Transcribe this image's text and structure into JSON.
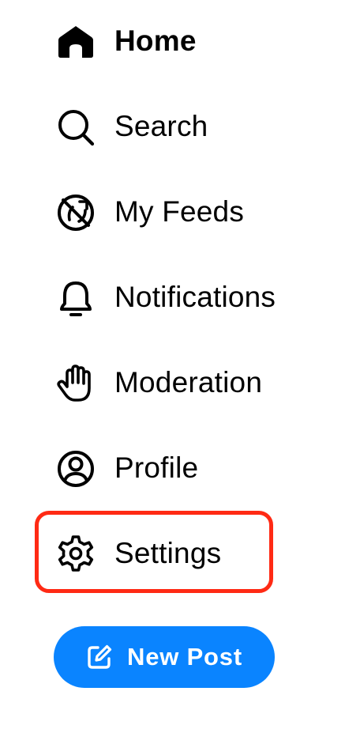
{
  "nav": {
    "items": [
      {
        "label": "Home",
        "icon": "home-icon",
        "active": true
      },
      {
        "label": "Search",
        "icon": "search-icon",
        "active": false
      },
      {
        "label": "My Feeds",
        "icon": "feeds-icon",
        "active": false
      },
      {
        "label": "Notifications",
        "icon": "bell-icon",
        "active": false
      },
      {
        "label": "Moderation",
        "icon": "hand-icon",
        "active": false
      },
      {
        "label": "Profile",
        "icon": "profile-icon",
        "active": false
      },
      {
        "label": "Settings",
        "icon": "gear-icon",
        "active": false
      }
    ]
  },
  "new_post": {
    "label": "New Post",
    "icon": "compose-icon",
    "color": "#0a84ff"
  },
  "highlight": {
    "target": "Settings",
    "color": "#ff2a14"
  }
}
